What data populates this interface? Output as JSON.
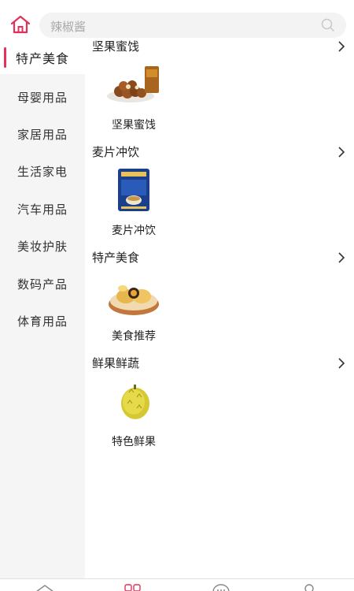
{
  "search": {
    "placeholder": "辣椒酱"
  },
  "sidebar": {
    "items": [
      {
        "label": "特产美食",
        "active": true
      },
      {
        "label": "母婴用品",
        "active": false
      },
      {
        "label": "家居用品",
        "active": false
      },
      {
        "label": "生活家电",
        "active": false
      },
      {
        "label": "汽车用品",
        "active": false
      },
      {
        "label": "美妆护肤",
        "active": false
      },
      {
        "label": "数码产品",
        "active": false
      },
      {
        "label": "体育用品",
        "active": false
      }
    ]
  },
  "sections": [
    {
      "title": "坚果蜜饯",
      "tile": {
        "label": "坚果蜜饯",
        "icon": "nuts-image"
      }
    },
    {
      "title": "麦片冲饮",
      "tile": {
        "label": "麦片冲饮",
        "icon": "cereal-image"
      }
    },
    {
      "title": "特产美食",
      "tile": {
        "label": "美食推荐",
        "icon": "pastry-image"
      }
    },
    {
      "title": "鲜果鲜蔬",
      "tile": {
        "label": "特色鲜果",
        "icon": "durian-image"
      }
    }
  ],
  "tabbar": {
    "tabs": [
      {
        "icon": "home-icon"
      },
      {
        "icon": "category-icon"
      },
      {
        "icon": "message-icon"
      },
      {
        "icon": "user-icon"
      }
    ]
  },
  "colors": {
    "accent": "#e0325a",
    "sidebar_bg": "#f5f5f5",
    "search_bg": "#f3f3f3"
  }
}
